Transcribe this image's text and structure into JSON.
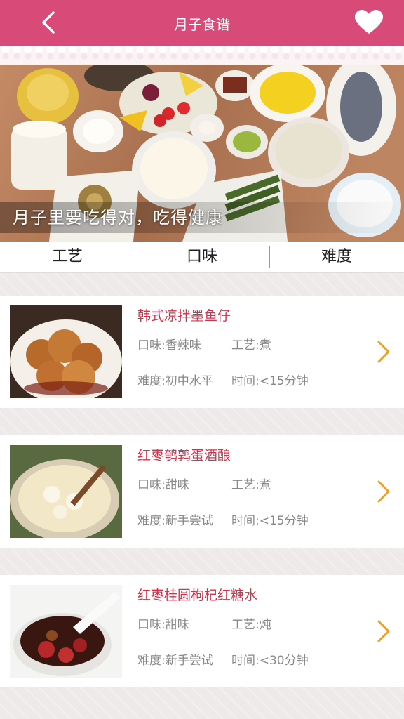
{
  "header": {
    "title": "月子食谱",
    "back_icon": "chevron-left-icon",
    "favorite_icon": "heart-icon"
  },
  "banner": {
    "caption": "月子里要吃得对，吃得健康"
  },
  "filters": [
    {
      "label": "工艺"
    },
    {
      "label": "口味"
    },
    {
      "label": "难度"
    }
  ],
  "recipes": [
    {
      "name": "韩式凉拌墨鱼仔",
      "taste": "口味:香辣味",
      "craft": "工艺:煮",
      "difficulty": "难度:初中水平",
      "time": "时间:<15分钟"
    },
    {
      "name": "红枣鹌鹑蛋酒酿",
      "taste": "口味:甜味",
      "craft": "工艺:煮",
      "difficulty": "难度:新手尝试",
      "time": "时间:<15分钟"
    },
    {
      "name": "红枣桂圆枸杞红糖水",
      "taste": "口味:甜味",
      "craft": "工艺:炖",
      "difficulty": "难度:新手尝试",
      "time": "时间:<30分钟"
    }
  ],
  "colors": {
    "header": "#d84a78",
    "recipe_title": "#d8304a",
    "chevron": "#f0a020"
  }
}
